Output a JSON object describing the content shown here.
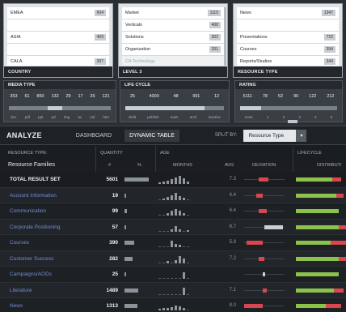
{
  "filters": {
    "country": {
      "caption": "COUNTRY",
      "items": [
        {
          "label": "EMEA",
          "count": "604"
        },
        {
          "label": "ASIA",
          "count": "409"
        },
        {
          "label": "CALA",
          "count": "397"
        }
      ]
    },
    "level3": {
      "caption": "LEVEL 3",
      "items": [
        {
          "label": "Market",
          "count": "1115"
        },
        {
          "label": "Verticals",
          "count": "408"
        },
        {
          "label": "Solutions",
          "count": "302"
        },
        {
          "label": "Organization",
          "count": "201"
        },
        {
          "label": "CA Technology",
          "count": "",
          "dim": true
        }
      ]
    },
    "resource_type": {
      "caption": "RESOURCE TYPE",
      "items": [
        {
          "label": "News",
          "count": "1347"
        },
        {
          "label": "",
          "count": ""
        },
        {
          "label": "Presentations",
          "count": "722"
        },
        {
          "label": "",
          "count": ""
        },
        {
          "label": "Courses",
          "count": "394"
        },
        {
          "label": "Reports/Studies",
          "count": "344"
        }
      ]
    }
  },
  "sliders": {
    "media_type": {
      "caption": "MEDIA TYPE",
      "values": [
        "353",
        "61",
        "850",
        "132",
        "29",
        "17",
        "26",
        "121"
      ],
      "ticks": [
        "doc",
        "pdf",
        "ppt",
        "pd",
        "img",
        "av",
        "vid",
        "htm"
      ],
      "selection": [
        0.38,
        0.52
      ]
    },
    "life_cycle": {
      "caption": "LIFE CYCLE",
      "values": [
        "25",
        "4000",
        "48",
        "991",
        "12"
      ],
      "ticks": [
        "draft",
        "publish",
        "main",
        "arch",
        "inactive"
      ],
      "selection": [
        0.0,
        0.8
      ]
    },
    "rating": {
      "caption": "RATING",
      "values": [
        "5111",
        "78",
        "52",
        "90",
        "122",
        "212"
      ],
      "ticks": [
        "none",
        "1",
        "2",
        "3",
        "4",
        "5"
      ],
      "selection": [
        0.0,
        0.22
      ]
    }
  },
  "toolbar": {
    "title": "ANALYZE",
    "tab_dashboard": "DASHBOARD",
    "tab_dynamic": "DYNAMIC TABLE",
    "split_label": "SPLIT BY:",
    "split_value": "Resource Type",
    "split_arrow": "▾"
  },
  "table": {
    "headers": {
      "resource_type": "RESOURCE TYPE:",
      "resource_families": "Resource Families",
      "quantity": "QUANTITY",
      "qty_num": "#",
      "qty_pct": "%",
      "age": "AGE",
      "months": "MONTHS",
      "avg": "AVG",
      "deviation": "DEVIATION",
      "lifecycle": "LIFECYCLE",
      "distribution": "DISTRIBUTI"
    },
    "rows": [
      {
        "name": "TOTAL RESULT SET",
        "qty": "5601",
        "pct": 1.0,
        "age_hist": [
          2,
          3,
          4,
          6,
          8,
          10,
          7,
          3
        ],
        "avg": "7.3",
        "dev_color": "#d8474f",
        "dev_from": 0.35,
        "dev_to": 0.6,
        "total": true
      },
      {
        "name": "Account Information",
        "qty": "19",
        "pct": 0.05,
        "age_hist": [
          0,
          2,
          4,
          6,
          9,
          5,
          3,
          0
        ],
        "avg": "4.4",
        "dev_color": "#d8474f",
        "dev_from": 0.3,
        "dev_to": 0.45
      },
      {
        "name": "Communication",
        "qty": "99",
        "pct": 0.1,
        "age_hist": [
          0,
          0,
          3,
          6,
          8,
          6,
          3,
          0
        ],
        "avg": "6.4",
        "dev_color": "#d8474f",
        "dev_from": 0.35,
        "dev_to": 0.55
      },
      {
        "name": "Corporate Positioning",
        "qty": "57",
        "pct": 0.06,
        "age_hist": [
          0,
          0,
          0,
          3,
          7,
          3,
          0,
          2
        ],
        "avg": "8.7",
        "dev_color": "#c9d0d5",
        "dev_from": 0.5,
        "dev_to": 0.95
      },
      {
        "name": "Courses",
        "qty": "390",
        "pct": 0.4,
        "age_hist": [
          0,
          0,
          0,
          8,
          4,
          3,
          0,
          0
        ],
        "avg": "5.8",
        "dev_color": "#d8474f",
        "dev_from": 0.05,
        "dev_to": 0.45
      },
      {
        "name": "Customer Success",
        "qty": "282",
        "pct": 0.33,
        "age_hist": [
          0,
          0,
          3,
          0,
          4,
          9,
          6,
          0
        ],
        "avg": "7.2",
        "dev_color": "#d8474f",
        "dev_from": 0.35,
        "dev_to": 0.5
      },
      {
        "name": "Campaigns/AODs",
        "qty": "25",
        "pct": 0.05,
        "age_hist": [
          0,
          0,
          0,
          0,
          0,
          0,
          8,
          0
        ],
        "avg": "",
        "dev_color": "#c9d0d5",
        "dev_from": 0.45,
        "dev_to": 0.52
      },
      {
        "name": "Literature",
        "qty": "1489",
        "pct": 0.55,
        "age_hist": [
          0,
          0,
          0,
          0,
          0,
          0,
          9,
          0
        ],
        "avg": "7.1",
        "dev_color": "#d8474f",
        "dev_from": 0.45,
        "dev_to": 0.55
      },
      {
        "name": "News",
        "qty": "1313",
        "pct": 0.52,
        "age_hist": [
          2,
          3,
          3,
          4,
          6,
          5,
          3,
          0
        ],
        "avg": "8.0",
        "dev_color": "#d8474f",
        "dev_from": 0.0,
        "dev_to": 0.45
      }
    ],
    "lifecycle_rows": [
      {
        "segs": [
          [
            "#8bc34a",
            0.0,
            0.72
          ],
          [
            "#d8474f",
            0.72,
            0.9
          ]
        ]
      },
      {
        "segs": [
          [
            "#8bc34a",
            0.0,
            0.8
          ],
          [
            "#d8474f",
            0.8,
            0.95
          ]
        ]
      },
      {
        "segs": [
          [
            "#8bc34a",
            0.0,
            0.85
          ]
        ]
      },
      {
        "segs": [
          [
            "#8bc34a",
            0.0,
            0.85
          ],
          [
            "#d8474f",
            0.85,
            1.0
          ]
        ]
      },
      {
        "segs": [
          [
            "#8bc34a",
            0.0,
            0.7
          ],
          [
            "#d8474f",
            0.7,
            1.0
          ]
        ]
      },
      {
        "segs": [
          [
            "#8bc34a",
            0.0,
            0.85
          ],
          [
            "#d8474f",
            0.85,
            1.0
          ]
        ]
      },
      {
        "segs": [
          [
            "#8bc34a",
            0.0,
            0.85
          ]
        ]
      },
      {
        "segs": [
          [
            "#8bc34a",
            0.0,
            0.75
          ],
          [
            "#d8474f",
            0.75,
            0.95
          ]
        ]
      },
      {
        "segs": [
          [
            "#8bc34a",
            0.0,
            0.6
          ],
          [
            "#d8474f",
            0.6,
            0.9
          ]
        ]
      }
    ]
  },
  "colors": {
    "accent_red": "#d8474f",
    "accent_green": "#8bc34a",
    "link_blue": "#6f8fd6"
  }
}
